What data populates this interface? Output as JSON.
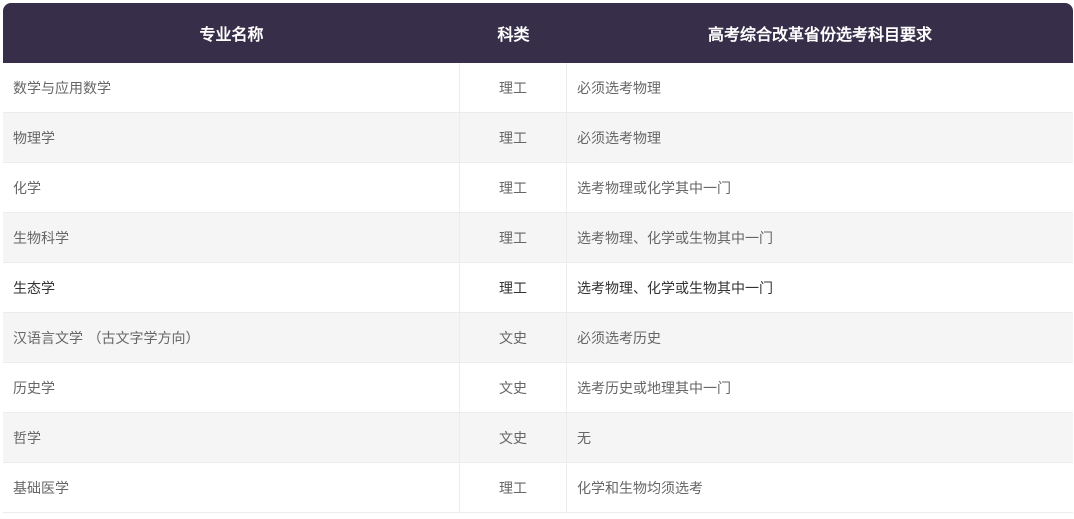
{
  "table": {
    "headers": {
      "name": "专业名称",
      "category": "科类",
      "requirement": "高考综合改革省份选考科目要求"
    },
    "rows": [
      {
        "name": "数学与应用数学",
        "category": "理工",
        "requirement": "必须选考物理"
      },
      {
        "name": "物理学",
        "category": "理工",
        "requirement": "必须选考物理"
      },
      {
        "name": "化学",
        "category": "理工",
        "requirement": "选考物理或化学其中一门"
      },
      {
        "name": "生物科学",
        "category": "理工",
        "requirement": "选考物理、化学或生物其中一门"
      },
      {
        "name": "生态学",
        "category": "理工",
        "requirement": "选考物理、化学或生物其中一门"
      },
      {
        "name": "汉语言文学 （古文字学方向）",
        "category": "文史",
        "requirement": "必须选考历史"
      },
      {
        "name": "历史学",
        "category": "文史",
        "requirement": "选考历史或地理其中一门"
      },
      {
        "name": "哲学",
        "category": "文史",
        "requirement": "无"
      },
      {
        "name": "基础医学",
        "category": "理工",
        "requirement": "化学和生物均须选考"
      }
    ]
  }
}
